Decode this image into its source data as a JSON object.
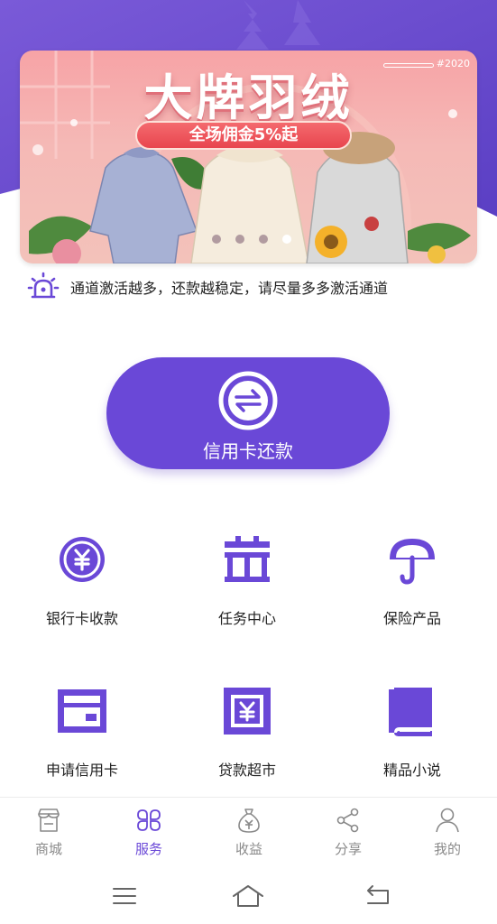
{
  "banner": {
    "title": "大牌羽绒",
    "subtitle": "全场佣金5%起",
    "year_tag": "#2020",
    "dots_count": 4,
    "active_dot": 3
  },
  "notice": {
    "icon": "alarm-light-icon",
    "text": "通道激活越多，还款越稳定，请尽量多多激活通道"
  },
  "main_action": {
    "label": "信用卡还款",
    "icon": "exchange-icon"
  },
  "services": [
    {
      "label": "银行卡收款",
      "icon": "yen-coin-icon"
    },
    {
      "label": "任务中心",
      "icon": "gift-icon"
    },
    {
      "label": "保险产品",
      "icon": "umbrella-icon"
    },
    {
      "label": "申请信用卡",
      "icon": "credit-card-icon"
    },
    {
      "label": "贷款超市",
      "icon": "yen-box-icon"
    },
    {
      "label": "精品小说",
      "icon": "book-icon"
    }
  ],
  "bottom_nav": [
    {
      "label": "商城",
      "icon": "store-icon",
      "active": false
    },
    {
      "label": "服务",
      "icon": "grid-cluster-icon",
      "active": true
    },
    {
      "label": "收益",
      "icon": "money-bag-icon",
      "active": false
    },
    {
      "label": "分享",
      "icon": "share-icon",
      "active": false
    },
    {
      "label": "我的",
      "icon": "person-icon",
      "active": false
    }
  ],
  "colors": {
    "primary": "#6a48d7",
    "header": "#6e4fd0",
    "inactive": "#8a8a8a"
  }
}
